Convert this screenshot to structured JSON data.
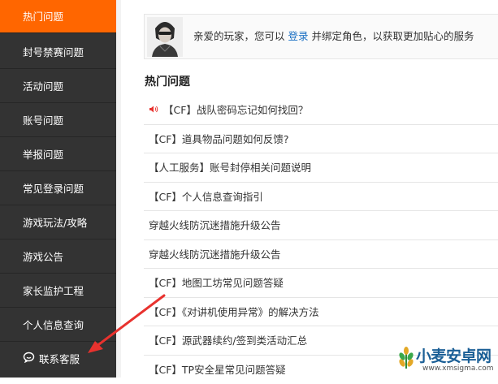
{
  "sidebar": {
    "items": [
      {
        "label": "热门问题",
        "active": true
      },
      {
        "label": "封号禁赛问题"
      },
      {
        "label": "活动问题"
      },
      {
        "label": "账号问题"
      },
      {
        "label": "举报问题"
      },
      {
        "label": "常见登录问题"
      },
      {
        "label": "游戏玩法/攻略"
      },
      {
        "label": "游戏公告"
      },
      {
        "label": "家长监护工程"
      },
      {
        "label": "个人信息查询"
      },
      {
        "label": "联系客服",
        "icon": "chat-bubble-icon"
      }
    ]
  },
  "notice": {
    "prefix": "亲爱的玩家，您可以",
    "link": "登录",
    "suffix": "并绑定角色，以获取更加贴心的服务"
  },
  "hot": {
    "title": "热门问题",
    "items": [
      {
        "text": "【CF】战队密码忘记如何找回？",
        "icon": "speaker-icon"
      },
      {
        "text": "【CF】道具物品问题如何反馈?"
      },
      {
        "text": "【人工服务】账号封停相关问题说明"
      },
      {
        "text": "【CF】个人信息查询指引"
      },
      {
        "text": "穿越火线防沉迷措施升级公告"
      },
      {
        "text": "穿越火线防沉迷措施升级公告"
      },
      {
        "text": "【CF】地图工坊常见问题答疑"
      },
      {
        "text": "【CF】《对讲机使用异常》的解决方法"
      },
      {
        "text": "【CF】源武器续约/签到类活动汇总"
      },
      {
        "text": "【CF】TP安全星常见问题答疑"
      }
    ]
  },
  "watermark": {
    "title": "小麦安卓网",
    "url": "www.xmsigma.com"
  },
  "colors": {
    "sidebar_bg": "#333333",
    "active_bg": "#ff6600",
    "link": "#1a6fc3",
    "annotation_arrow": "#e8322e"
  }
}
